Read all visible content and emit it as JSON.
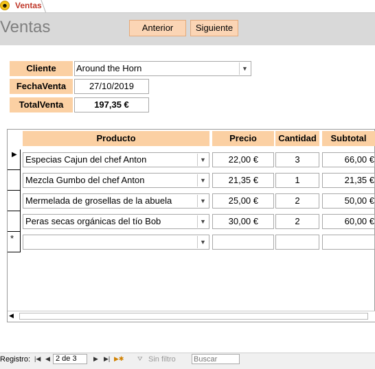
{
  "tab": {
    "label": "Ventas",
    "icon": "smiley-form-icon"
  },
  "header": {
    "title": "Ventas",
    "prev_label": "Anterior",
    "next_label": "Siguiente"
  },
  "form": {
    "cliente_label": "Cliente",
    "cliente_value": "Around the Horn",
    "fecha_label": "FechaVenta",
    "fecha_value": "27/10/2019",
    "total_label": "TotalVenta",
    "total_value": "197,35 €"
  },
  "subform": {
    "columns": [
      "Producto",
      "Precio",
      "Cantidad",
      "Subtotal"
    ],
    "rows": [
      {
        "producto": "Especias Cajun del chef Anton",
        "precio": "22,00 €",
        "cantidad": "3",
        "subtotal": "66,00 €"
      },
      {
        "producto": "Mezcla Gumbo del chef Anton",
        "precio": "21,35 €",
        "cantidad": "1",
        "subtotal": "21,35 €"
      },
      {
        "producto": "Mermelada de grosellas de la abuela",
        "precio": "25,00 €",
        "cantidad": "2",
        "subtotal": "50,00 €"
      },
      {
        "producto": "Peras secas orgánicas del tío Bob",
        "precio": "30,00 €",
        "cantidad": "2",
        "subtotal": "60,00 €"
      }
    ],
    "new_row_marker": "*"
  },
  "statusbar": {
    "registro_label": "Registro:",
    "record_position": "2 de 3",
    "filter_label": "Sin filtro",
    "search_placeholder": "Buscar"
  },
  "colors": {
    "accent": "#fbd0a3",
    "header_band": "#d9d9d9",
    "tab_label": "#c0392b"
  }
}
